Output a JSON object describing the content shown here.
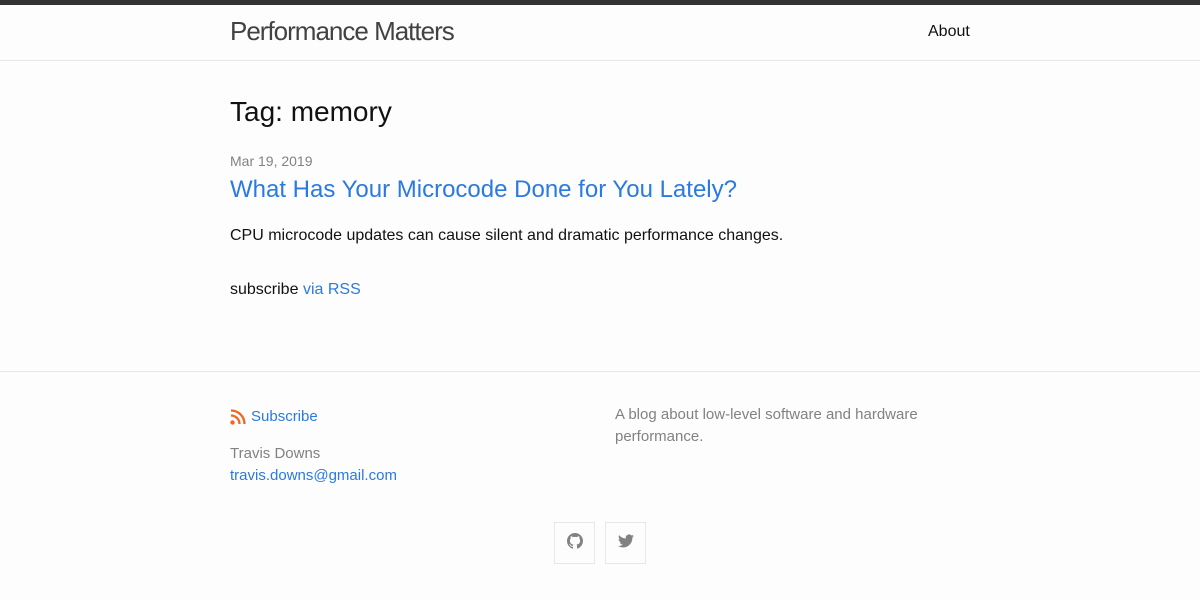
{
  "header": {
    "site_title": "Performance Matters",
    "nav": [
      {
        "label": "About"
      }
    ]
  },
  "main": {
    "heading": "Tag: memory",
    "posts": [
      {
        "date": "Mar 19, 2019",
        "title": "What Has Your Microcode Done for You Lately?",
        "excerpt": "CPU microcode updates can cause silent and dramatic performance changes."
      }
    ],
    "subscribe_text": "subscribe",
    "rss_link": "via RSS"
  },
  "footer": {
    "subscribe_label": "Subscribe",
    "author": "Travis Downs",
    "email": "travis.downs@gmail.com",
    "description": "A blog about low-level software and hardware performance.",
    "social": [
      "github-icon",
      "twitter-icon"
    ]
  },
  "colors": {
    "link": "#2a7ae2",
    "muted": "#828282",
    "rss": "#f26522",
    "top_bar": "#333333"
  }
}
